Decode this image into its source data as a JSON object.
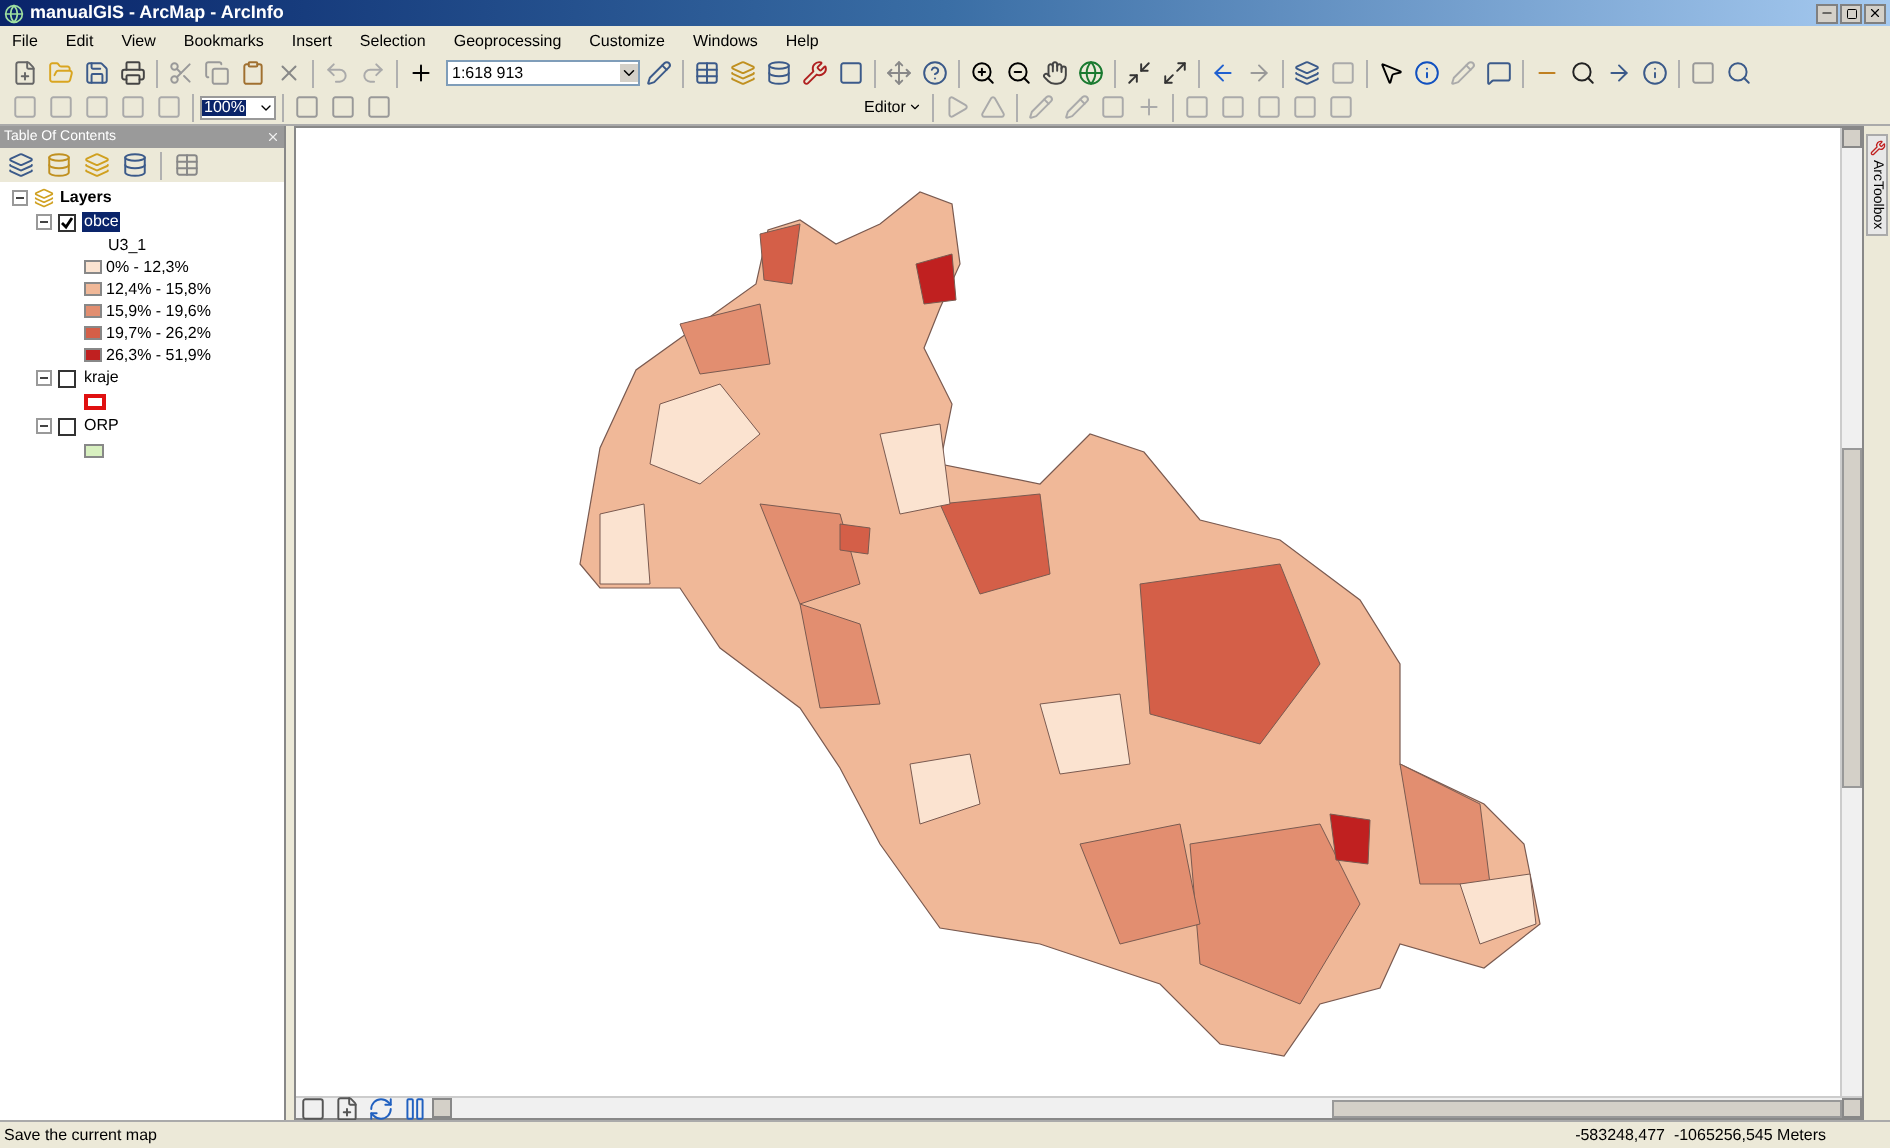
{
  "window": {
    "title": "manualGIS - ArcMap - ArcInfo"
  },
  "menu": [
    "File",
    "Edit",
    "View",
    "Bookmarks",
    "Insert",
    "Selection",
    "Geoprocessing",
    "Customize",
    "Windows",
    "Help"
  ],
  "toolbar": {
    "scale": "1:618 913",
    "zoom": "100%",
    "editor": "Editor"
  },
  "toc": {
    "title": "Table Of Contents",
    "root": {
      "label": "Layers",
      "expanded": true,
      "children": [
        {
          "label": "obce",
          "checked": true,
          "selected": true,
          "expanded": true,
          "field": "U3_1",
          "classes": [
            {
              "label": "0% - 12,3%",
              "color": "#fbe3d0"
            },
            {
              "label": "12,4% - 15,8%",
              "color": "#f0b898"
            },
            {
              "label": "15,9% - 19,6%",
              "color": "#e28e70"
            },
            {
              "label": "19,7% - 26,2%",
              "color": "#d45f48"
            },
            {
              "label": "26,3% - 51,9%",
              "color": "#c02020"
            }
          ]
        },
        {
          "label": "kraje",
          "checked": false,
          "selected": false,
          "expanded": true,
          "symbol": {
            "kind": "outline",
            "color": "#e01010"
          }
        },
        {
          "label": "ORP",
          "checked": false,
          "selected": false,
          "expanded": true,
          "symbol": {
            "kind": "fill",
            "color": "#d8f0c0"
          }
        }
      ]
    }
  },
  "side_tab": "ArcToolbox",
  "status_bar": {
    "message": "Save the current map",
    "coordinates": "-583248,477  -1065256,545 Meters"
  }
}
